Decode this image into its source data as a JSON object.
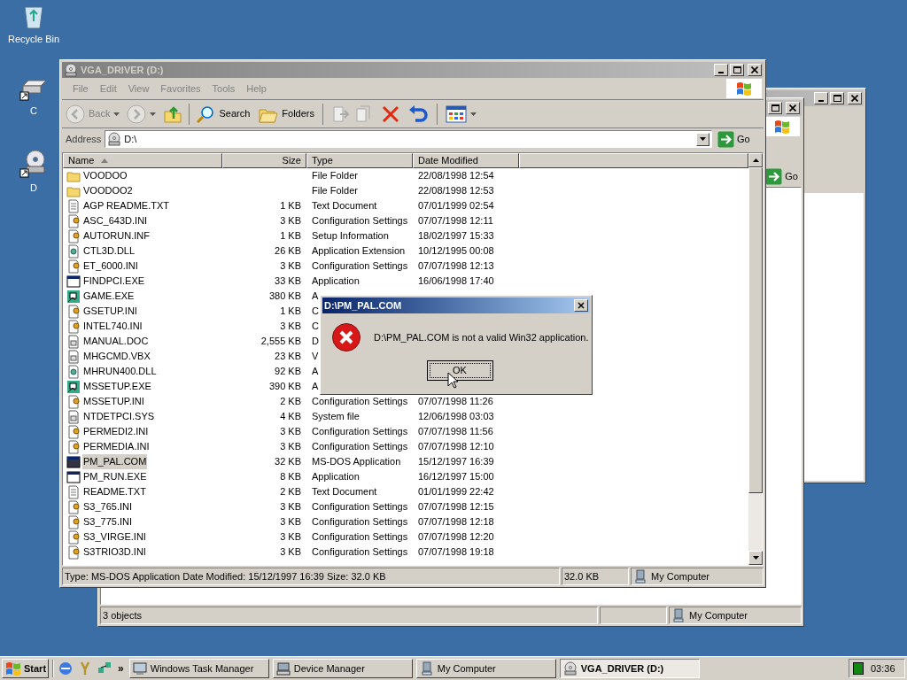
{
  "desktop_icons": [
    {
      "label": "Recycle Bin",
      "kind": "recycle"
    },
    {
      "label": "C",
      "kind": "drive"
    },
    {
      "label": "D",
      "kind": "cd"
    }
  ],
  "back_window": {
    "go": "Go",
    "status_text": "3 objects",
    "status_zone": "My Computer"
  },
  "window": {
    "title": "VGA_DRIVER (D:)",
    "menu": [
      "File",
      "Edit",
      "View",
      "Favorites",
      "Tools",
      "Help"
    ],
    "toolbar": {
      "back": "Back",
      "search": "Search",
      "folders": "Folders"
    },
    "address": {
      "label": "Address",
      "value": "D:\\",
      "go": "Go"
    },
    "columns": [
      {
        "label": "Name",
        "sorted": true
      },
      {
        "label": "Size",
        "sorted": false
      },
      {
        "label": "Type",
        "sorted": false
      },
      {
        "label": "Date Modified",
        "sorted": false
      }
    ],
    "rows": [
      {
        "name": "VOODOO",
        "kind": "folder",
        "type": "File Folder",
        "date": "22/08/1998 12:54",
        "selected": false
      },
      {
        "name": "VOODOO2",
        "kind": "folder",
        "type": "File Folder",
        "date": "22/08/1998 12:53",
        "selected": false
      },
      {
        "name": "AGP README.TXT",
        "kind": "text",
        "size": "1 KB",
        "type": "Text Document",
        "date": "07/01/1999 02:54",
        "selected": false
      },
      {
        "name": "ASC_643D.INI",
        "kind": "ini",
        "size": "3 KB",
        "type": "Configuration Settings",
        "date": "07/07/1998 12:11",
        "selected": false
      },
      {
        "name": "AUTORUN.INF",
        "kind": "ini",
        "size": "1 KB",
        "type": "Setup Information",
        "date": "18/02/1997 15:33",
        "selected": false
      },
      {
        "name": "CTL3D.DLL",
        "kind": "dll",
        "size": "26 KB",
        "type": "Application Extension",
        "date": "10/12/1995 00:08",
        "selected": false
      },
      {
        "name": "ET_6000.INI",
        "kind": "ini",
        "size": "3 KB",
        "type": "Configuration Settings",
        "date": "07/07/1998 12:13",
        "selected": false
      },
      {
        "name": "FINDPCI.EXE",
        "kind": "app",
        "size": "33 KB",
        "type": "Application",
        "date": "16/06/1998 17:40",
        "selected": false
      },
      {
        "name": "GAME.EXE",
        "kind": "setup",
        "size": "380 KB",
        "type": "A",
        "selected": false
      },
      {
        "name": "GSETUP.INI",
        "kind": "ini",
        "size": "1 KB",
        "type": "C",
        "selected": false
      },
      {
        "name": "INTEL740.INI",
        "kind": "ini",
        "size": "3 KB",
        "type": "C",
        "selected": false
      },
      {
        "name": "MANUAL.DOC",
        "kind": "doc",
        "size": "2,555 KB",
        "type": "D",
        "selected": false
      },
      {
        "name": "MHGCMD.VBX",
        "kind": "doc",
        "size": "23 KB",
        "type": "V",
        "selected": false
      },
      {
        "name": "MHRUN400.DLL",
        "kind": "dll",
        "size": "92 KB",
        "type": "A",
        "selected": false
      },
      {
        "name": "MSSETUP.EXE",
        "kind": "setup",
        "size": "390 KB",
        "type": "A",
        "selected": false
      },
      {
        "name": "MSSETUP.INI",
        "kind": "ini",
        "size": "2 KB",
        "type": "Configuration Settings",
        "date": "07/07/1998 11:26",
        "selected": false
      },
      {
        "name": "NTDETPCI.SYS",
        "kind": "doc",
        "size": "4 KB",
        "type": "System file",
        "date": "12/06/1998 03:03",
        "selected": false
      },
      {
        "name": "PERMEDI2.INI",
        "kind": "ini",
        "size": "3 KB",
        "type": "Configuration Settings",
        "date": "07/07/1998 11:56",
        "selected": false
      },
      {
        "name": "PERMEDIA.INI",
        "kind": "ini",
        "size": "3 KB",
        "type": "Configuration Settings",
        "date": "07/07/1998 12:10",
        "selected": false
      },
      {
        "name": "PM_PAL.COM",
        "kind": "dos",
        "size": "32 KB",
        "type": "MS-DOS Application",
        "date": "15/12/1997 16:39",
        "selected": true
      },
      {
        "name": "PM_RUN.EXE",
        "kind": "app",
        "size": "8 KB",
        "type": "Application",
        "date": "16/12/1997 15:00",
        "selected": false
      },
      {
        "name": "README.TXT",
        "kind": "text",
        "size": "2 KB",
        "type": "Text Document",
        "date": "01/01/1999 22:42",
        "selected": false
      },
      {
        "name": "S3_765.INI",
        "kind": "ini",
        "size": "3 KB",
        "type": "Configuration Settings",
        "date": "07/07/1998 12:15",
        "selected": false
      },
      {
        "name": "S3_775.INI",
        "kind": "ini",
        "size": "3 KB",
        "type": "Configuration Settings",
        "date": "07/07/1998 12:18",
        "selected": false
      },
      {
        "name": "S3_VIRGE.INI",
        "kind": "ini",
        "size": "3 KB",
        "type": "Configuration Settings",
        "date": "07/07/1998 12:20",
        "selected": false
      },
      {
        "name": "S3TRIO3D.INI",
        "kind": "ini",
        "size": "3 KB",
        "type": "Configuration Settings",
        "date": "07/07/1998 19:18",
        "selected": false
      }
    ],
    "status_bar": {
      "text": "Type: MS-DOS Application Date Modified: 15/12/1997 16:39 Size: 32.0 KB",
      "size": "32.0 KB",
      "zone": "My Computer"
    }
  },
  "dialog": {
    "title": "D:\\PM_PAL.COM",
    "message": "D:\\PM_PAL.COM is not a valid Win32 application.",
    "button": "OK"
  },
  "taskbar": {
    "start": "Start",
    "more": "»",
    "tasks": [
      {
        "label": "Windows Task Manager",
        "kind": "taskmgr",
        "selected": false
      },
      {
        "label": "Device Manager",
        "kind": "devmgr",
        "selected": false
      },
      {
        "label": "My Computer",
        "kind": "computer",
        "selected": false
      },
      {
        "label": "VGA_DRIVER (D:)",
        "kind": "cd",
        "selected": true
      }
    ],
    "clock": "03:36"
  }
}
